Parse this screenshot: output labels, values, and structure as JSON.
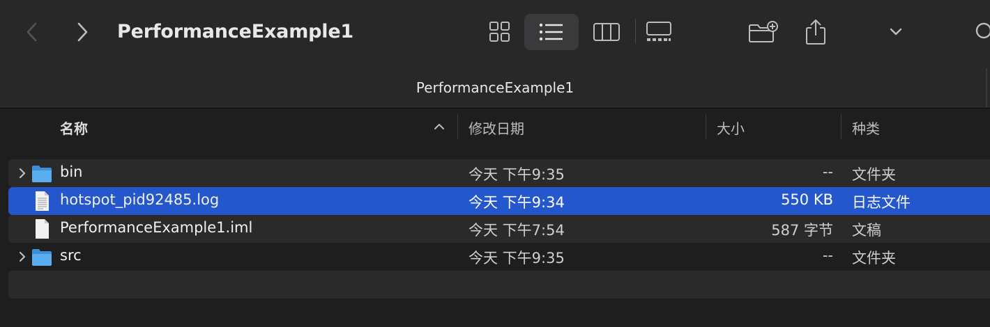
{
  "window": {
    "title": "PerformanceExample1",
    "path_title": "PerformanceExample1"
  },
  "columns": {
    "name": "名称",
    "modified": "修改日期",
    "size": "大小",
    "kind": "种类"
  },
  "rows": [
    {
      "name": "bin",
      "modified": "今天 下午9:35",
      "size": "--",
      "kind": "文件夹",
      "icon": "folder-icon"
    },
    {
      "name": "hotspot_pid92485.log",
      "modified": "今天 下午9:34",
      "size": "550 KB",
      "kind": "日志文件",
      "icon": "log-file-icon"
    },
    {
      "name": "PerformanceExample1.iml",
      "modified": "今天 下午7:54",
      "size": "587 字节",
      "kind": "文稿",
      "icon": "document-icon"
    },
    {
      "name": "src",
      "modified": "今天 下午9:35",
      "size": "--",
      "kind": "文件夹",
      "icon": "folder-icon"
    }
  ],
  "colors": {
    "selection": "#2457cc",
    "folder": "#5aaef0",
    "background": "#1e1e1e",
    "toolbar": "#282828"
  }
}
